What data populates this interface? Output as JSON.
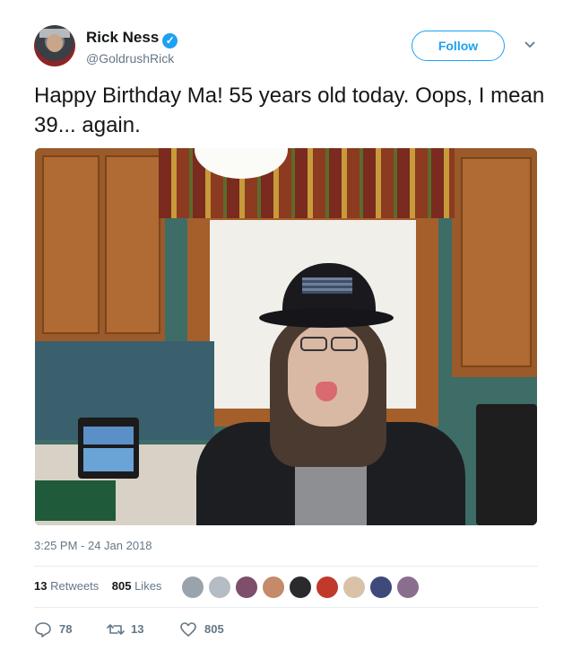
{
  "user": {
    "name": "Rick Ness",
    "handle": "@GoldrushRick",
    "follow_label": "Follow"
  },
  "tweet": {
    "text": "Happy Birthday Ma! 55 years old today. Oops, I mean 39... again.",
    "timestamp": "3:25 PM - 24 Jan 2018"
  },
  "stats": {
    "retweets_count": "13",
    "retweets_label": "Retweets",
    "likes_count": "805",
    "likes_label": "Likes"
  },
  "actions": {
    "reply_count": "78",
    "retweet_count": "13",
    "like_count": "805"
  },
  "colors": {
    "accent": "#1da1f2",
    "muted": "#657786",
    "text": "#14171a"
  }
}
